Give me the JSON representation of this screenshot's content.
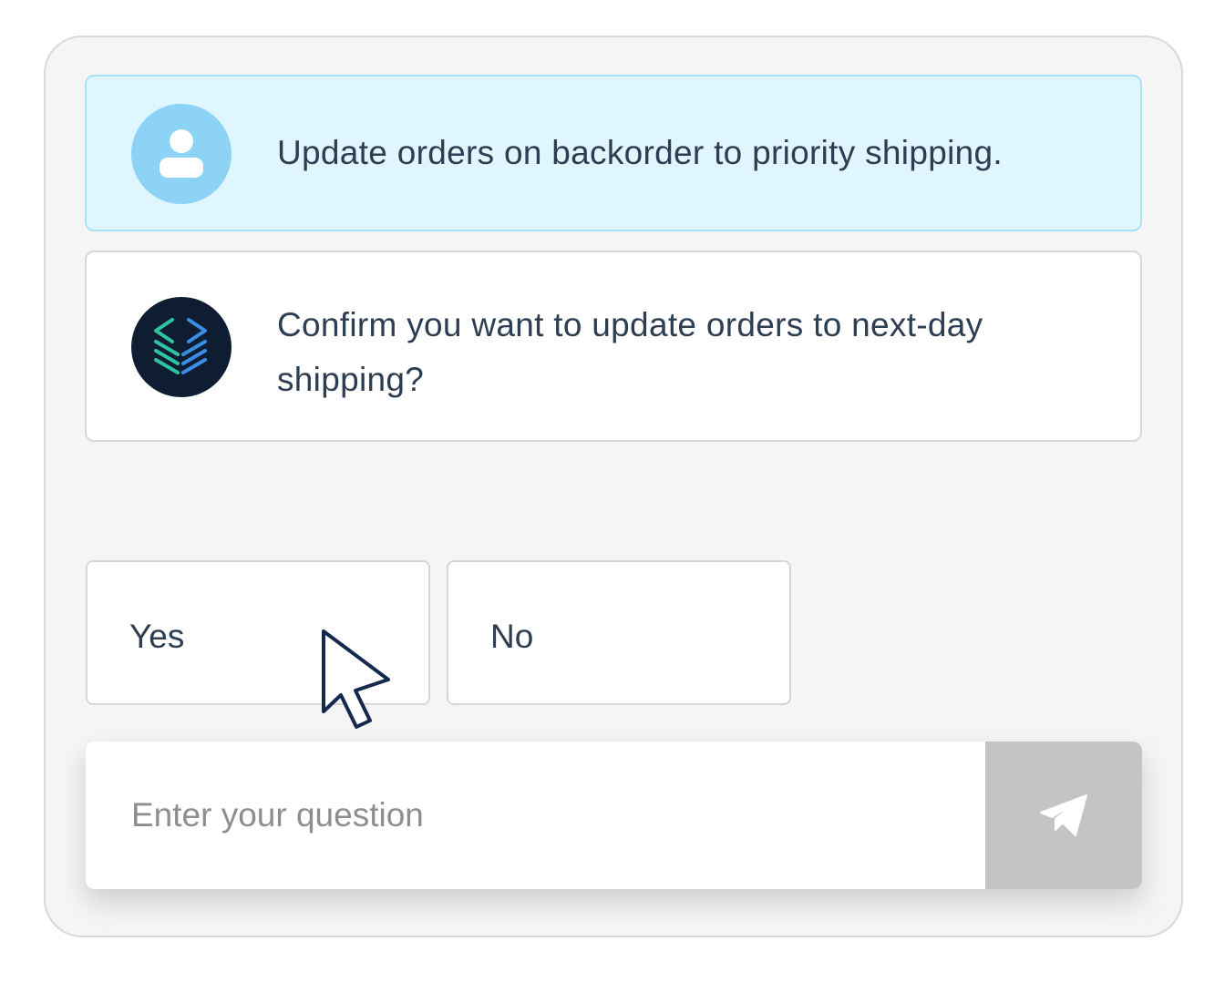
{
  "conversation": {
    "user_message": "Update orders on backorder to priority shipping.",
    "bot_message": "Confirm you want to update orders to next-day shipping?",
    "user_avatar_icon": "user-icon",
    "bot_avatar_icon": "layers-code-logo-icon"
  },
  "choices": {
    "yes_label": "Yes",
    "no_label": "No"
  },
  "composer": {
    "placeholder": "Enter your question",
    "value": "",
    "send_icon": "paper-plane-icon"
  },
  "colors": {
    "user_bubble": "#e0f6fe",
    "user_avatar": "#8dd3f5",
    "bot_avatar": "#0f1d33",
    "logo_green": "#2ec4a0",
    "logo_blue": "#3a8ee6",
    "send_button": "#c4c4c4",
    "text": "#2d3e52"
  }
}
